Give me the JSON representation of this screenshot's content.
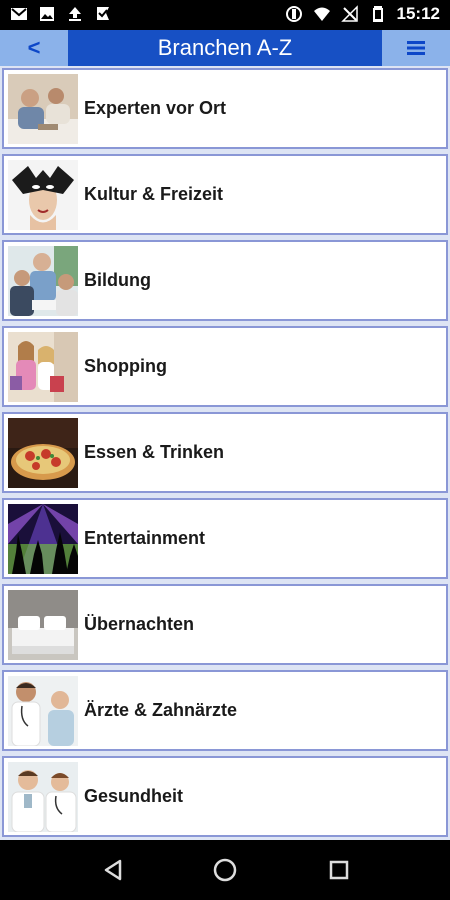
{
  "status_bar": {
    "time": "15:12",
    "icons_left": [
      "gmail-icon",
      "image-icon",
      "upload-icon",
      "check-flag-icon"
    ],
    "icons_right": [
      "vibrate-icon",
      "wifi-icon",
      "no-signal-icon",
      "battery-icon"
    ]
  },
  "header": {
    "back_label": "<",
    "title": "Branchen A-Z",
    "menu_icon": "hamburger-menu-icon",
    "bg_color": "#1750c4",
    "button_color": "#8bb2ea"
  },
  "categories": [
    {
      "label": "Experten vor Ort",
      "icon": "experts-photo"
    },
    {
      "label": "Kultur & Freizeit",
      "icon": "mask-photo"
    },
    {
      "label": "Bildung",
      "icon": "education-photo"
    },
    {
      "label": "Shopping",
      "icon": "shopping-photo"
    },
    {
      "label": "Essen & Trinken",
      "icon": "pizza-photo"
    },
    {
      "label": "Entertainment",
      "icon": "concert-photo"
    },
    {
      "label": "Übernachten",
      "icon": "hotel-bed-photo"
    },
    {
      "label": "Ärzte & Zahnärzte",
      "icon": "doctor-photo"
    },
    {
      "label": "Gesundheit",
      "icon": "health-photo"
    }
  ],
  "nav_bar": {
    "buttons": [
      "back-triangle-icon",
      "home-circle-icon",
      "recents-square-icon"
    ]
  }
}
